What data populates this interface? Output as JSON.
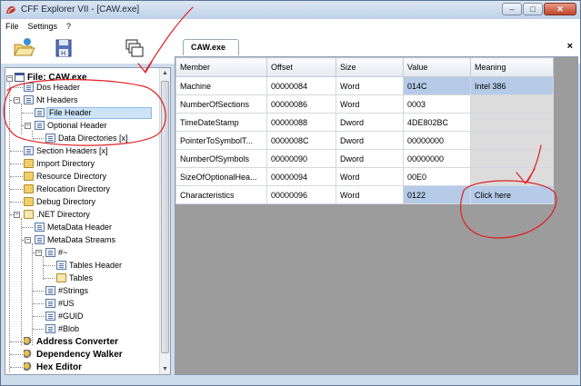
{
  "window": {
    "title": "CFF Explorer VII - [CAW.exe]",
    "buttons": {
      "minimize": "–",
      "maximize": "□",
      "close": "✕"
    }
  },
  "menu": [
    "File",
    "Settings",
    "?"
  ],
  "toolbar": {
    "icons": [
      "open-folder-icon",
      "save-disk-icon",
      "windows-icon"
    ]
  },
  "tab": {
    "label": "CAW.exe",
    "close": "×"
  },
  "tree": {
    "root": "File: CAW.exe",
    "items": [
      "Dos Header",
      "Nt Headers",
      "File Header",
      "Optional Header",
      "Data Directories [x]",
      "Section Headers [x]",
      "Import Directory",
      "Resource Directory",
      "Relocation Directory",
      "Debug Directory",
      ".NET Directory",
      "MetaData Header",
      "MetaData Streams",
      "#~",
      "Tables Header",
      "Tables",
      "#Strings",
      "#US",
      "#GUID",
      "#Blob",
      "Address Converter",
      "Dependency Walker",
      "Hex Editor"
    ]
  },
  "grid": {
    "columns": [
      "Member",
      "Offset",
      "Size",
      "Value",
      "Meaning"
    ],
    "rows": [
      [
        "Machine",
        "00000084",
        "Word",
        "014C",
        "Intel 386"
      ],
      [
        "NumberOfSections",
        "00000086",
        "Word",
        "0003",
        ""
      ],
      [
        "TimeDateStamp",
        "00000088",
        "Dword",
        "4DE802BC",
        ""
      ],
      [
        "PointerToSymbolT...",
        "0000008C",
        "Dword",
        "00000000",
        ""
      ],
      [
        "NumberOfSymbols",
        "00000090",
        "Dword",
        "00000000",
        ""
      ],
      [
        "SizeOfOptionalHea...",
        "00000094",
        "Word",
        "00E0",
        ""
      ],
      [
        "Characteristics",
        "00000096",
        "Word",
        "0122",
        "Click here"
      ]
    ]
  },
  "colors": {
    "selection": "#cde4f8",
    "value_highlight": "#b6cbe8",
    "annotation_red": "#e02020"
  }
}
